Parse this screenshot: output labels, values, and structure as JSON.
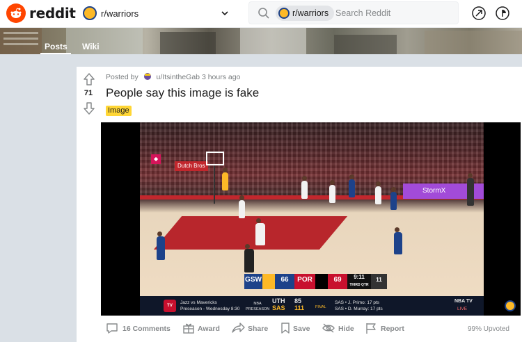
{
  "header": {
    "logo_text": "reddit",
    "community": "r/warriors",
    "search_chip": "r/warriors",
    "search_placeholder": "Search Reddit",
    "icons": [
      "reddit-logo-icon",
      "warriors-logo-icon",
      "chevron-down-icon",
      "search-icon",
      "popular-arrow-icon",
      "stats-icon"
    ]
  },
  "subnav": {
    "tabs": [
      {
        "label": "Posts",
        "active": true
      },
      {
        "label": "Wiki",
        "active": false
      }
    ]
  },
  "post": {
    "score": "71",
    "posted_by_prefix": "Posted by",
    "author": "u/ItsintheGab",
    "time": "3 hours ago",
    "title": "People say this image is fake",
    "flair": "Image",
    "flair_color": "#ffd635",
    "actions": {
      "comments": "16 Comments",
      "award": "Award",
      "share": "Share",
      "save": "Save",
      "hide": "Hide",
      "report": "Report"
    },
    "upvoted": "99% Upvoted"
  },
  "video": {
    "ad_boards": [
      "StormX",
      "Dutch Bros"
    ],
    "scoreboard": {
      "team1": "GSW",
      "score1": "66",
      "team2": "POR",
      "score2": "69",
      "clock": "9:11",
      "quarter": "THIRD QTR",
      "shot_clock": "11"
    },
    "ticker": {
      "promo_line1": "Jazz vs Mavericks",
      "promo_line2": "Preseason - Wednesday 8:30",
      "game_type": "NBA PRESEASON",
      "away_team": "UTH",
      "away_score": "85",
      "home_team": "SAS",
      "home_score": "111",
      "status": "FINAL",
      "stat1": "SAS • J. Primo: 17 pts",
      "stat2": "SAS • D. Murray: 17 pts",
      "live_label": "NBA TV",
      "live_sub": "LIVE"
    }
  },
  "colors": {
    "brand": "#ff4500",
    "warriors_blue": "#1d428a",
    "warriors_gold": "#fdb927",
    "page_bg": "#dae0e6",
    "meta_gray": "#878a8c"
  }
}
